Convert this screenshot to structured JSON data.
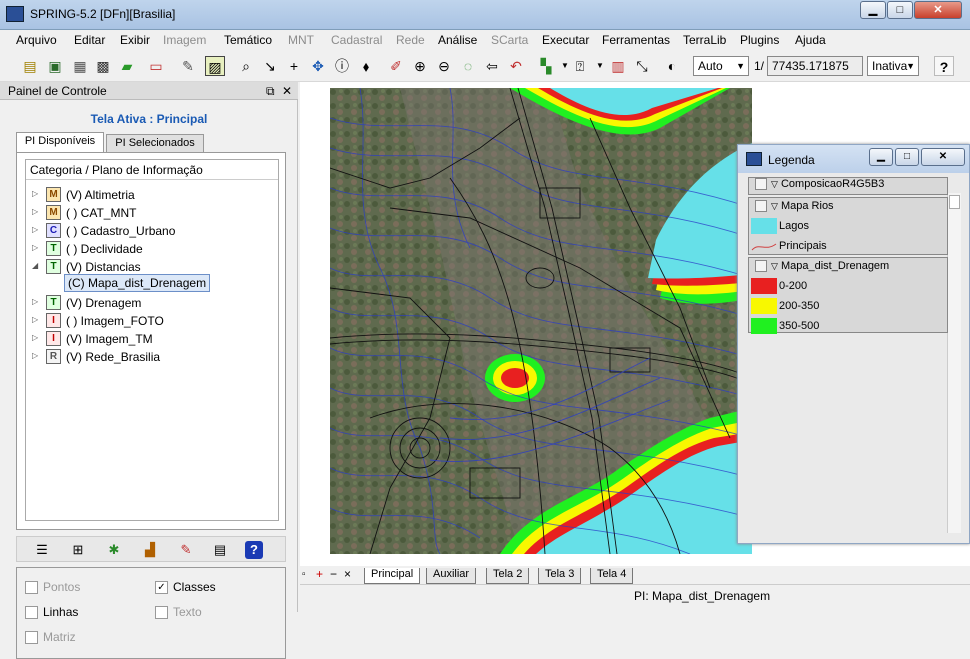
{
  "window": {
    "title": "SPRING-5.2 [DFn][Brasilia]",
    "minimize": "▁",
    "maximize": "□",
    "close": "✕"
  },
  "menu": [
    {
      "label": "Arquivo",
      "enabled": true
    },
    {
      "label": "Editar",
      "enabled": true
    },
    {
      "label": "Exibir",
      "enabled": true
    },
    {
      "label": "Imagem",
      "enabled": false
    },
    {
      "label": "Temático",
      "enabled": true
    },
    {
      "label": "MNT",
      "enabled": false
    },
    {
      "label": "Cadastral",
      "enabled": false
    },
    {
      "label": "Rede",
      "enabled": false
    },
    {
      "label": "Análise",
      "enabled": true
    },
    {
      "label": "SCarta",
      "enabled": false
    },
    {
      "label": "Executar",
      "enabled": true
    },
    {
      "label": "Ferramentas",
      "enabled": true
    },
    {
      "label": "TerraLib",
      "enabled": true
    },
    {
      "label": "Plugins",
      "enabled": true
    },
    {
      "label": "Ajuda",
      "enabled": true
    }
  ],
  "toolbar": {
    "zoom_mode": "Auto",
    "scale_prefix": "1/",
    "scale_value": "77435.171875",
    "cursor_mode": "Inativa",
    "help": "?"
  },
  "panel": {
    "title": "Painel de Controle",
    "float_icon": "⧉",
    "close_icon": "✕",
    "active_view": "Tela Ativa : Principal",
    "tabs": [
      "PI Disponíveis",
      "PI Selecionados"
    ],
    "tree_header": "Categoria / Plano de Informação",
    "categories": [
      {
        "icon": "M",
        "label": "(V) Altimetria",
        "expanded": false
      },
      {
        "icon": "M",
        "label": "( ) CAT_MNT",
        "expanded": false
      },
      {
        "icon": "C",
        "label": "( ) Cadastro_Urbano",
        "expanded": false
      },
      {
        "icon": "T",
        "label": "( ) Declividade",
        "expanded": false
      },
      {
        "icon": "T",
        "label": "(V) Distancias",
        "expanded": true
      },
      {
        "icon": "T",
        "label": "(V) Drenagem",
        "expanded": false
      },
      {
        "icon": "I",
        "label": "( ) Imagem_FOTO",
        "expanded": false
      },
      {
        "icon": "I",
        "label": "(V) Imagem_TM",
        "expanded": false
      },
      {
        "icon": "R",
        "label": "(V) Rede_Brasilia",
        "expanded": false
      }
    ],
    "selected_plan": "(C) Mapa_dist_Drenagem",
    "options": {
      "pontos": "Pontos",
      "classes": "Classes",
      "linhas": "Linhas",
      "texto": "Texto",
      "matriz": "Matriz"
    }
  },
  "view_tabs": [
    "Principal",
    "Auxiliar",
    "Tela 2",
    "Tela 3",
    "Tela 4"
  ],
  "view_tab_controls": [
    "▫",
    "+",
    "−",
    "×"
  ],
  "status_text": "PI: Mapa_dist_Drenagem",
  "legend": {
    "title": "Legenda",
    "groups": [
      {
        "name": "ComposicaoR4G5B3",
        "items": []
      },
      {
        "name": "Mapa Rios",
        "items": [
          {
            "label": "Lagos",
            "color": "#66e0e8"
          },
          {
            "label": "Principais",
            "color": "#d04040"
          }
        ]
      },
      {
        "name": "Mapa_dist_Drenagem",
        "items": [
          {
            "label": "0-200",
            "color": "#e82020"
          },
          {
            "label": "200-350",
            "color": "#f8f800"
          },
          {
            "label": "350-500",
            "color": "#20f020"
          }
        ]
      }
    ]
  },
  "colors": {
    "active_view_text": "#1a5ab4",
    "water": "#66e0e8",
    "contour": "#2a3cc8",
    "dist_red": "#e82020",
    "dist_yellow": "#f8f800",
    "dist_green": "#20f020"
  }
}
